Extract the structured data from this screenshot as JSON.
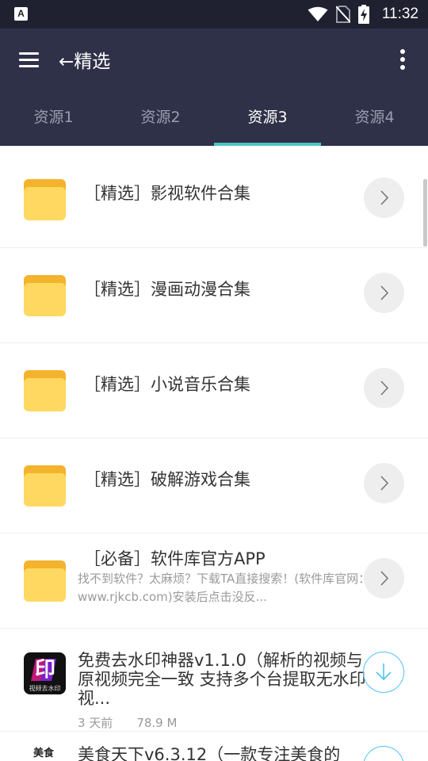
{
  "status_bar": {
    "app_icon_letter": "A",
    "icons": [
      "wifi-icon",
      "no-sim-icon",
      "battery-charging-icon"
    ],
    "time": "11:32"
  },
  "app_bar": {
    "title": "←精选",
    "menu_icon": "menu-icon",
    "more_icon": "more-vert-icon"
  },
  "tabs": [
    {
      "label": "资源1",
      "active": false
    },
    {
      "label": "资源2",
      "active": false
    },
    {
      "label": "资源3",
      "active": true
    },
    {
      "label": "资源4",
      "active": false
    }
  ],
  "folders": [
    {
      "title": "［精选］影视软件合集"
    },
    {
      "title": "［精选］漫画动漫合集"
    },
    {
      "title": "［精选］小说音乐合集"
    },
    {
      "title": "［精选］破解游戏合集"
    },
    {
      "title": "［必备］软件库官方APP",
      "desc": "找不到软件？太麻烦？下载TA直接搜索！(软件库官网：www.rjkcb.com)安装后点击没反..."
    }
  ],
  "apps": [
    {
      "icon_glyph": "印",
      "icon_caption": "视频去水印",
      "title": "免费去水印神器v1.1.0（解析的视频与原视频完全一致 支持多个台提取无水印视...",
      "date": "3 天前",
      "size": "78.9 M"
    },
    {
      "icon_glyph": "美食",
      "title": "美食天下v6.3.12（一款专注美食的"
    }
  ],
  "colors": {
    "status_bar": "#1f2030",
    "app_bar": "#2f3148",
    "tab_indicator": "#4fc3c5",
    "folder": "#ffd861",
    "download_accent": "#4fc3f7"
  }
}
